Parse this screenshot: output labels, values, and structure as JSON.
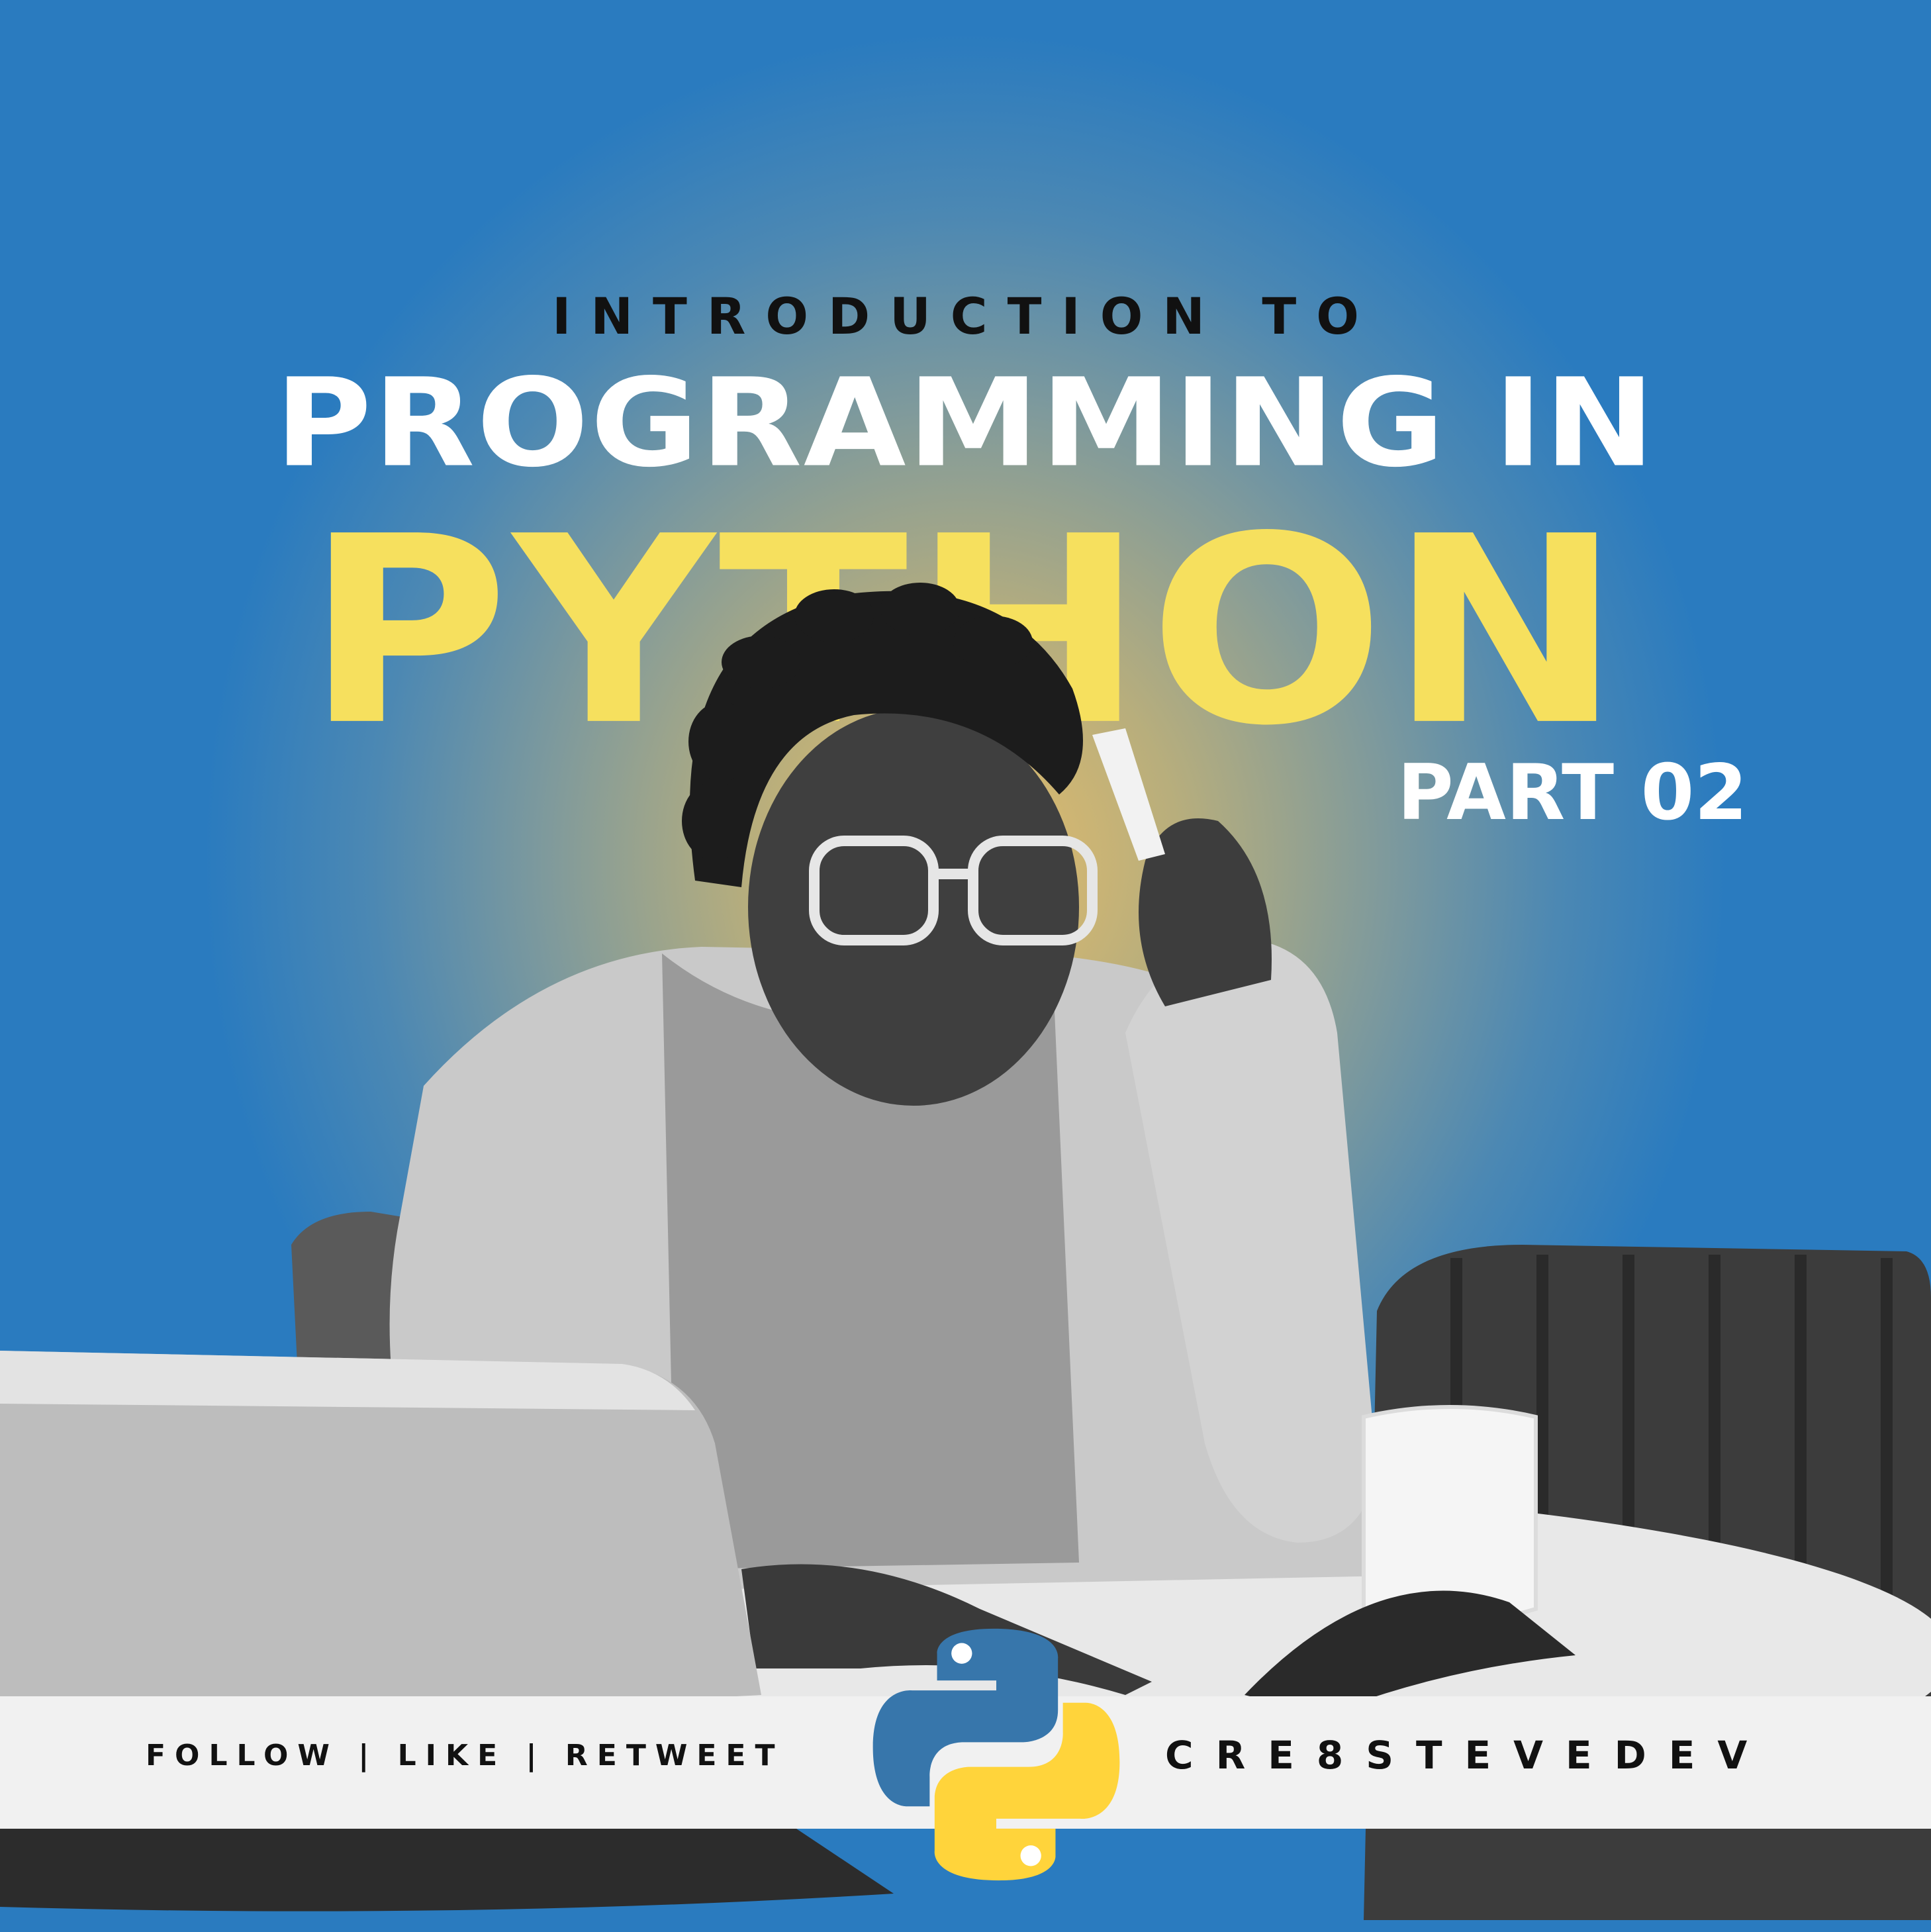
{
  "headline": {
    "intro": "INTRODUCTION TO",
    "line1": "PROGRAMMING IN",
    "line2": "PYTHON",
    "part": "PART 02"
  },
  "footer": {
    "left": "FOLLOW | LIKE | RETWEET",
    "right": "CRE8STEVEDEV"
  },
  "colors": {
    "bg_blue": "#2a7bbf",
    "glow": "#e6bd6a",
    "accent_yellow": "#f6e05e",
    "python_blue": "#3776ab",
    "python_yellow": "#ffd43b"
  },
  "icons": [
    "python-logo-icon"
  ]
}
